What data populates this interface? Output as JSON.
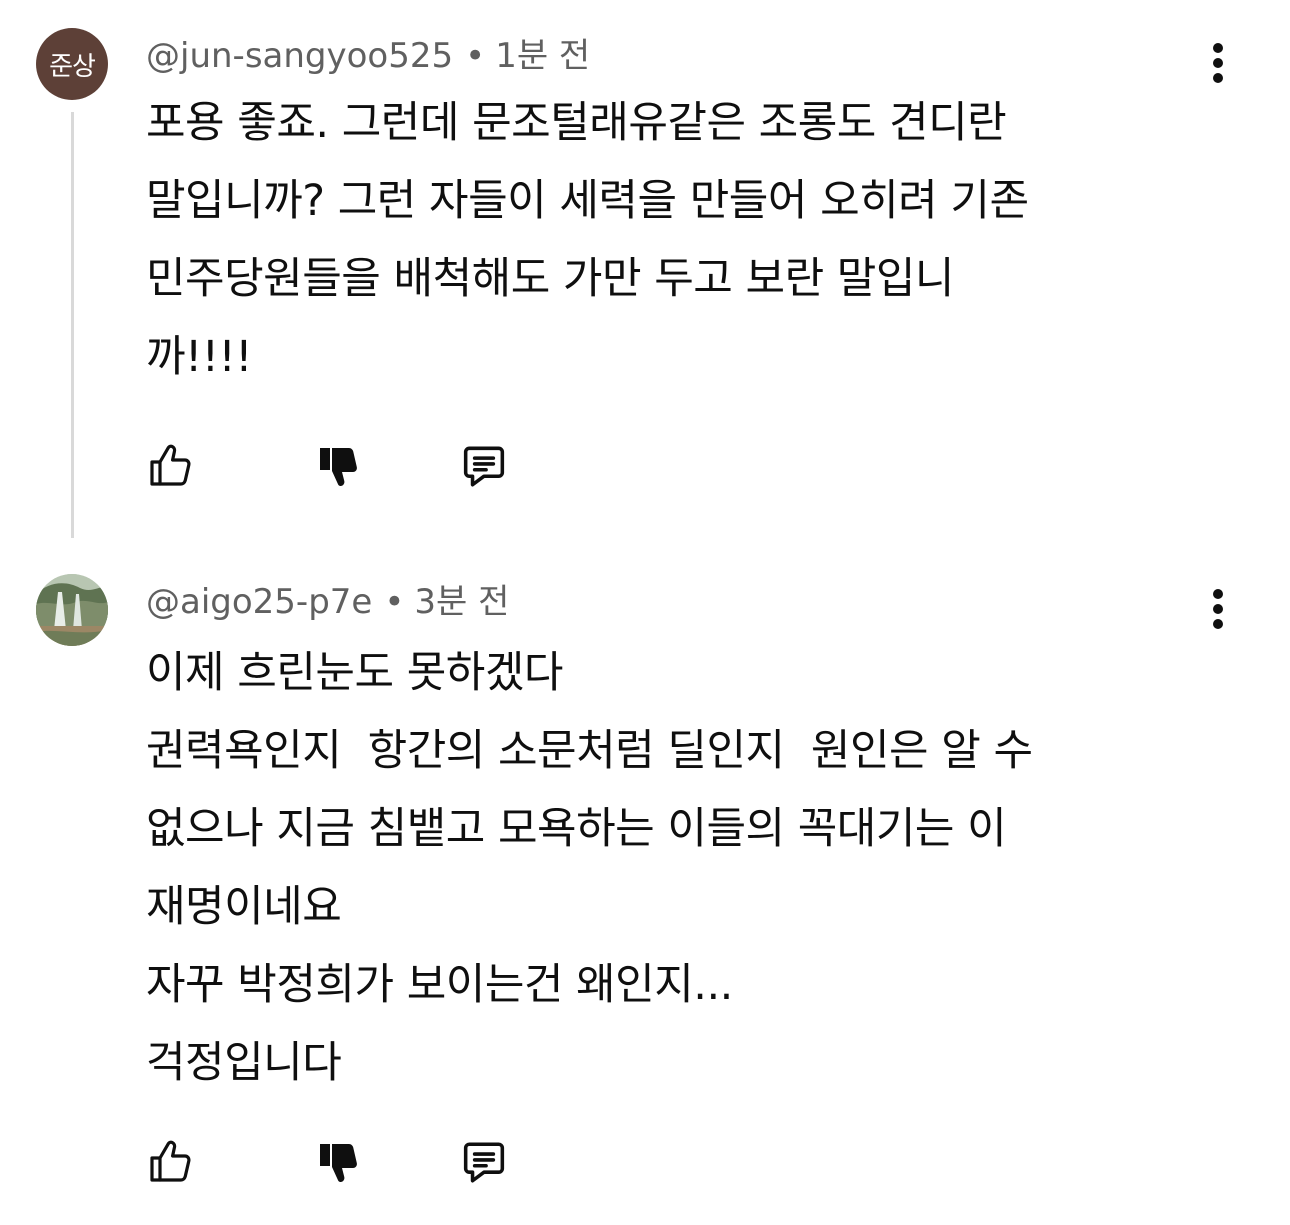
{
  "comments": [
    {
      "avatar_text": "준상",
      "avatar_color": "#5d4037",
      "author": "@jun-sangyoo525",
      "separator": "•",
      "time": "1분 전",
      "text": "포용 좋죠. 그런데 문조털래유같은 조롱도 견디란\n말입니까? 그런 자들이 세력을 만들어 오히려 기존\n민주당원들을 배척해도 가만 두고 보란 말입니\n까!!!!",
      "icons": {
        "more": "more-vert-icon",
        "like": "thumb-up-outline-icon",
        "dislike": "thumb-down-filled-icon",
        "reply": "comment-icon"
      }
    },
    {
      "avatar_text": "",
      "author": "@aigo25-p7e",
      "separator": "•",
      "time": "3분 전",
      "text": "이제 흐린눈도 못하겠다\n권력욕인지  항간의 소문처럼 딜인지  원인은 알 수\n없으나 지금 침뱉고 모욕하는 이들의 꼭대기는 이\n재명이네요\n자꾸 박정희가 보이는건 왜인지...\n걱정입니다",
      "icons": {
        "more": "more-vert-icon",
        "like": "thumb-up-outline-icon",
        "dislike": "thumb-down-filled-icon",
        "reply": "comment-icon"
      }
    }
  ],
  "colors": {
    "text_primary": "#0f0f0f",
    "text_secondary": "#606060",
    "thread_line": "#d9d9d9"
  }
}
